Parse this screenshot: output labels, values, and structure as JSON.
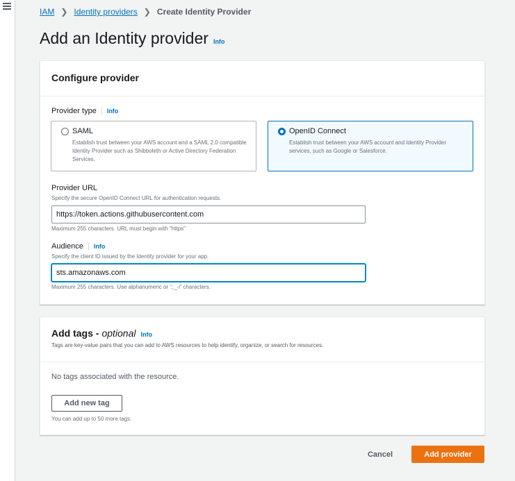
{
  "breadcrumb": {
    "items": [
      {
        "label": "IAM"
      },
      {
        "label": "Identity providers"
      },
      {
        "label": "Create Identity Provider"
      }
    ]
  },
  "page": {
    "title": "Add an Identity provider",
    "info_label": "Info"
  },
  "configure": {
    "title": "Configure provider",
    "provider_type": {
      "label": "Provider type",
      "info_label": "Info",
      "options": [
        {
          "label": "SAML",
          "description": "Establish trust between your AWS account and a SAML 2.0 compatible Identity Provider such as Shibboleth or Active Directory Federation Services.",
          "selected": false
        },
        {
          "label": "OpenID Connect",
          "description": "Establish trust between your AWS account and Identity Provider services, such as Google or Salesforce.",
          "selected": true
        }
      ]
    },
    "provider_url": {
      "label": "Provider URL",
      "description": "Specify the secure OpenID Connect URL for authentication requests.",
      "value": "https://token.actions.githubusercontent.com",
      "constraint": "Maximum 255 characters. URL must begin with \"https\""
    },
    "audience": {
      "label": "Audience",
      "info_label": "Info",
      "description": "Specify the client ID issued by the Identity provider for your app.",
      "value": "sts.amazonaws.com",
      "constraint": "Maximum 255 characters. Use alphanumeric or ';:_-/' characters."
    }
  },
  "tags": {
    "title": "Add tags -",
    "title_optional": "optional",
    "info_label": "Info",
    "description": "Tags are key-value pairs that you can add to AWS resources to help identify, organize, or search for resources.",
    "empty_text": "No tags associated with the resource.",
    "add_button": "Add new tag",
    "limit_text": "You can add up to 50 more tags."
  },
  "footer": {
    "cancel_label": "Cancel",
    "submit_label": "Add provider"
  },
  "colors": {
    "link": "#0073bb",
    "primary_button": "#ec7211",
    "selected_tile_bg": "#f1faff",
    "page_bg": "#f2f3f3"
  },
  "icons": [
    "menu-icon",
    "chevron-right-icon",
    "radio-icon"
  ]
}
